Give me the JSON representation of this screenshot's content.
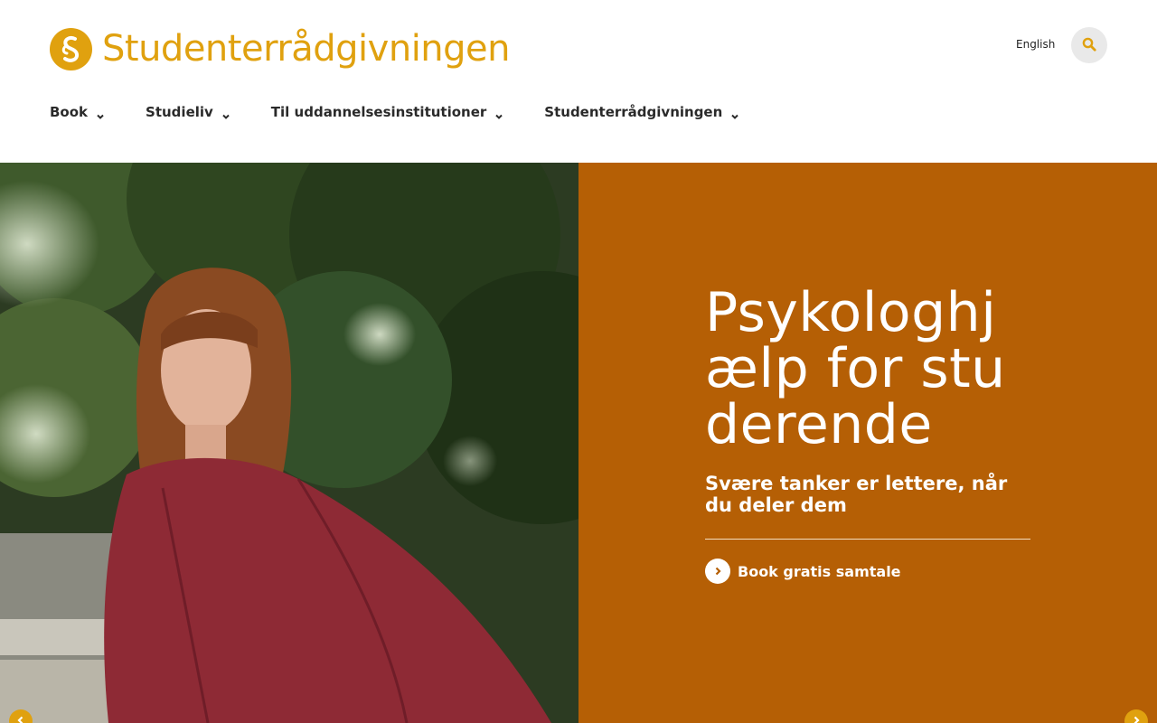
{
  "site": {
    "name": "Studenterrådgivningen",
    "brand_color": "#e0a10f",
    "panel_color": "#b55f05"
  },
  "header": {
    "language_link": "English",
    "search_icon": "search-icon"
  },
  "nav": {
    "items": [
      {
        "label": "Book"
      },
      {
        "label": "Studieliv"
      },
      {
        "label": "Til uddannelsesinstitutioner"
      },
      {
        "label": "Studenterrådgivningen"
      }
    ]
  },
  "hero": {
    "title": "Psykologhjælp for studerende",
    "subtitle": "Svære tanker er lettere, når du deler dem",
    "cta_label": "Book gratis samtale",
    "cta_icon": "chevron-right-icon",
    "prev_icon": "chevron-left-icon",
    "next_icon": "chevron-right-icon"
  }
}
